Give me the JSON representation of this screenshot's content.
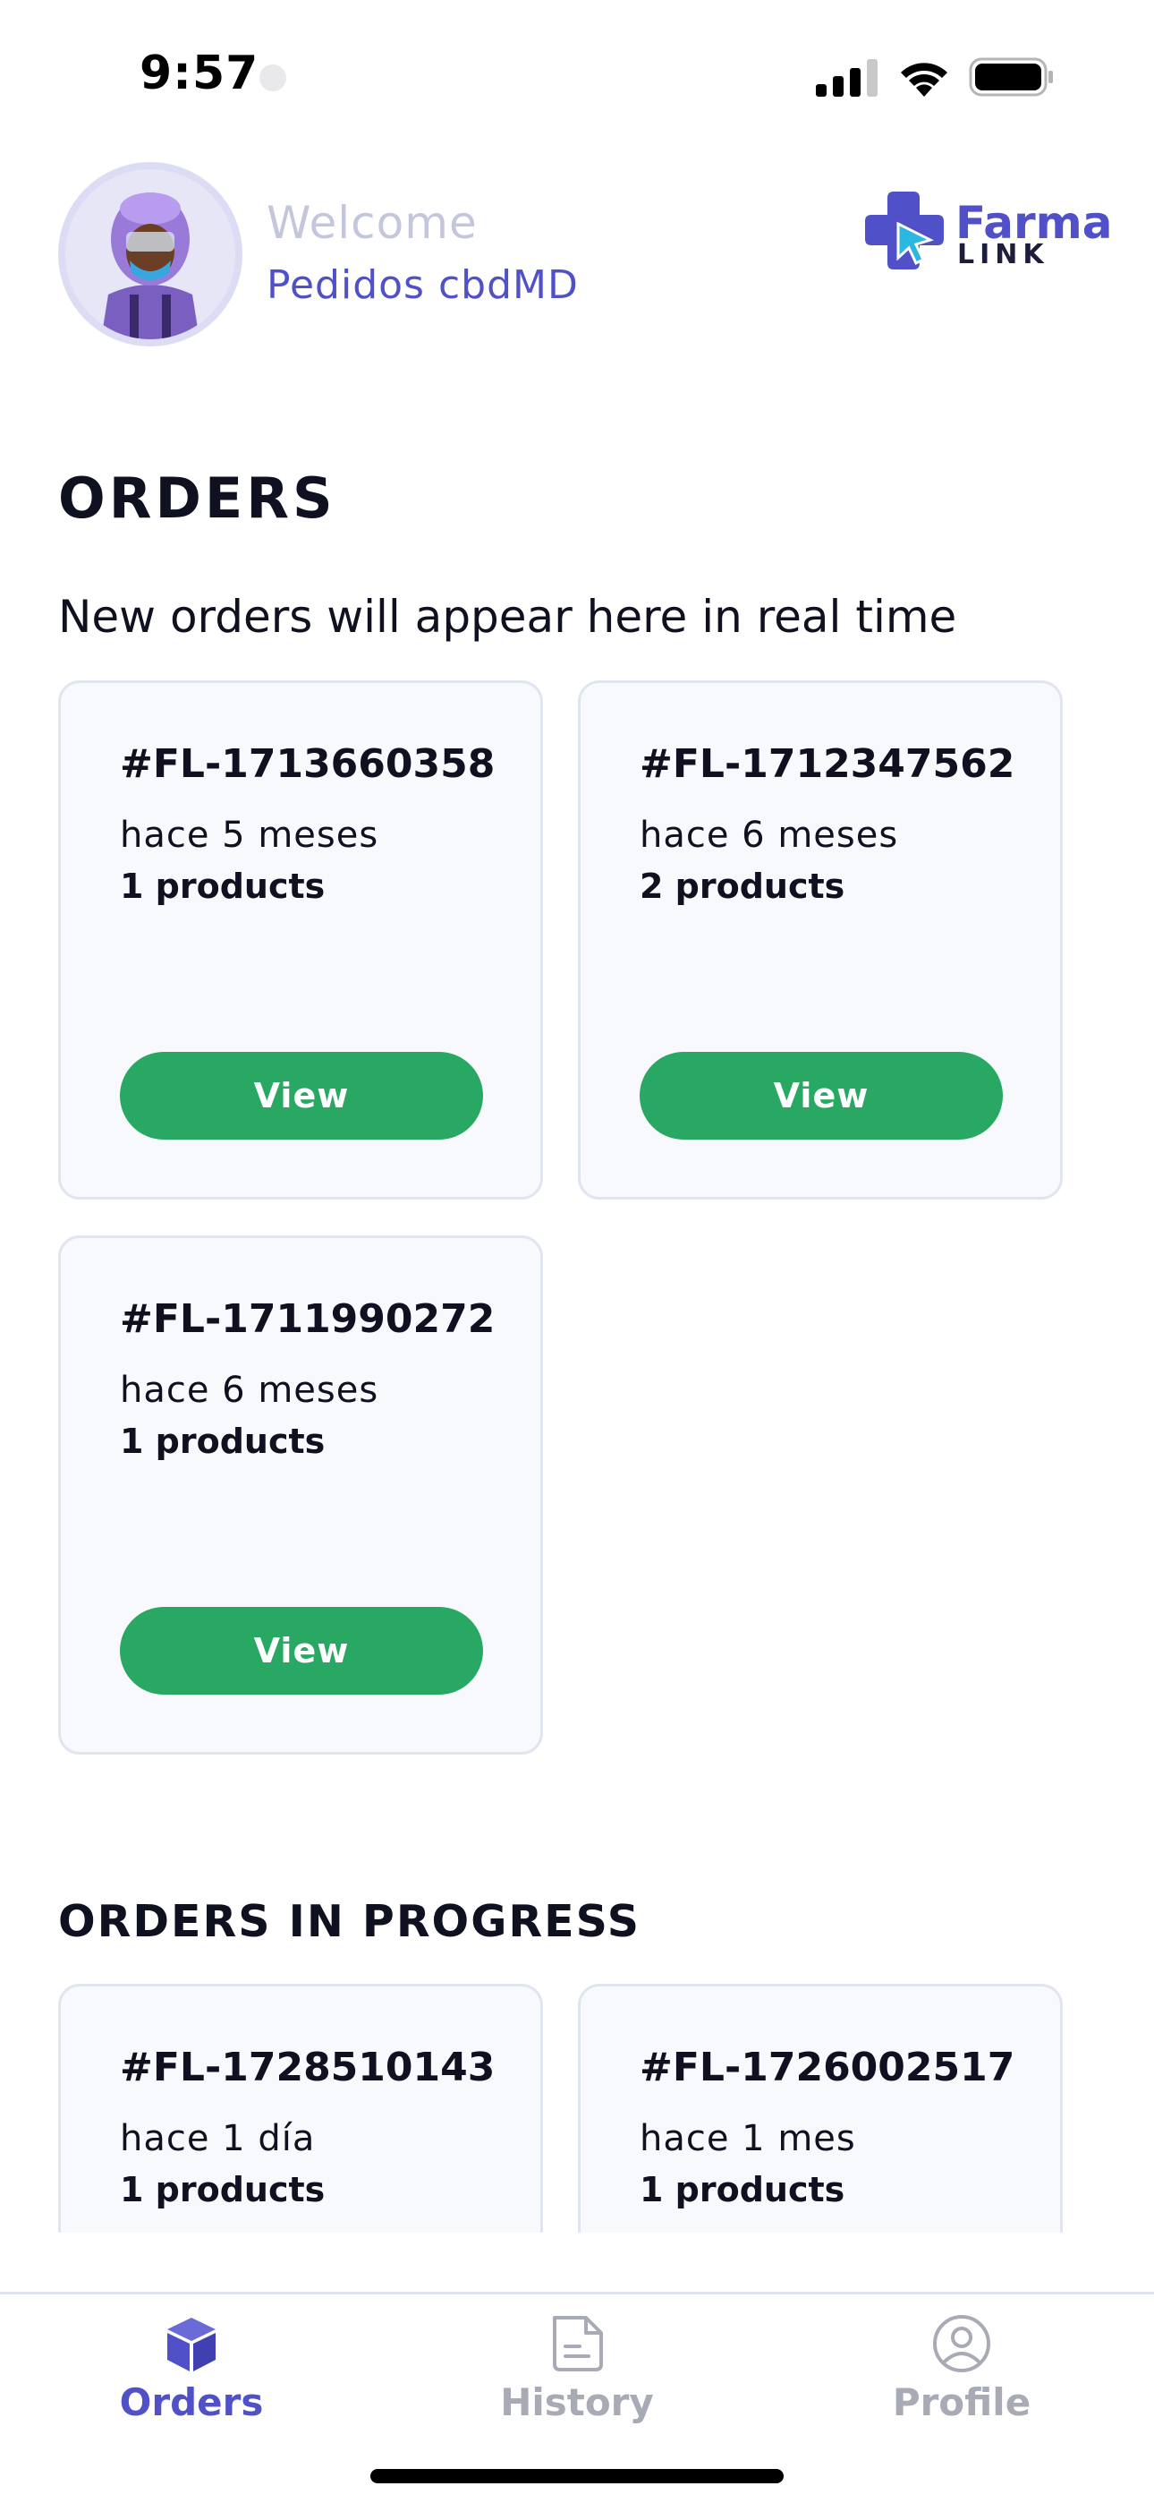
{
  "status_bar": {
    "time": "9:57"
  },
  "header": {
    "welcome": "Welcome",
    "user_name": "Pedidos cbdMD",
    "brand": {
      "name_primary": "Farma",
      "name_secondary": "LINK",
      "color": "#5050c8"
    }
  },
  "orders": {
    "title": "ORDERS",
    "subtitle": "New orders will appear here in real time",
    "cards": [
      {
        "id": "#FL-1713660358",
        "time": "hace 5 meses",
        "products": "1 products",
        "button": "View"
      },
      {
        "id": "#FL-1712347562",
        "time": "hace 6 meses",
        "products": "2 products",
        "button": "View"
      },
      {
        "id": "#FL-1711990272",
        "time": "hace 6 meses",
        "products": "1 products",
        "button": "View"
      }
    ]
  },
  "in_progress": {
    "title": "ORDERS IN PROGRESS",
    "cards": [
      {
        "id": "#FL-1728510143",
        "time": "hace 1 día",
        "products": "1 products"
      },
      {
        "id": "#FL-1726002517",
        "time": "hace 1 mes",
        "products": "1 products"
      }
    ]
  },
  "tab_bar": {
    "tabs": [
      {
        "label": "Orders",
        "icon": "cube-icon",
        "active": true
      },
      {
        "label": "History",
        "icon": "document-icon",
        "active": false
      },
      {
        "label": "Profile",
        "icon": "user-circle-icon",
        "active": false
      }
    ]
  },
  "colors": {
    "accent": "#5050c8",
    "button_green": "#28a862",
    "card_bg": "#f8f9fd",
    "muted": "#c4c6dc"
  }
}
